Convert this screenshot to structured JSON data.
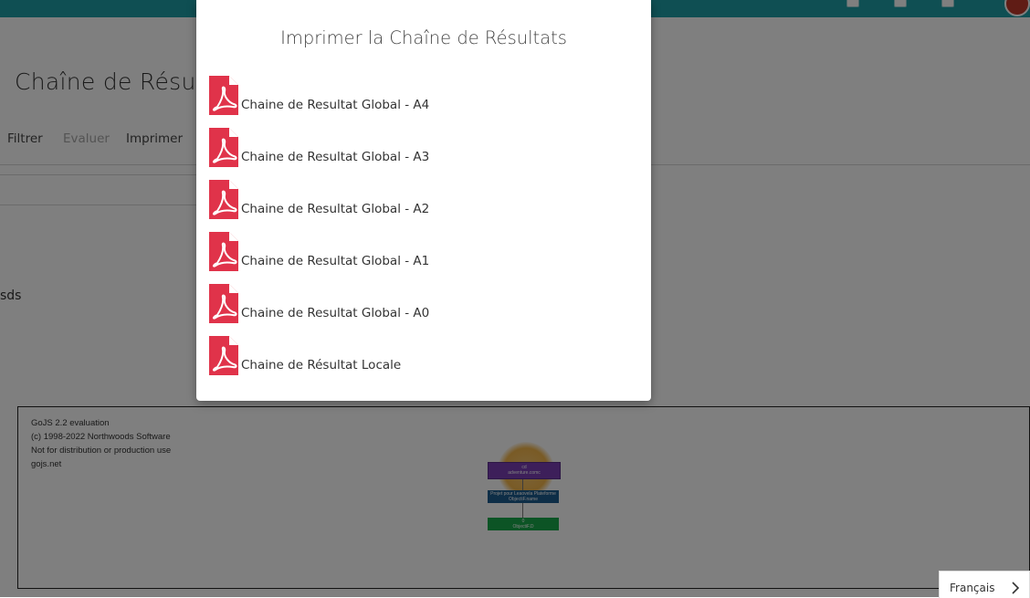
{
  "header": {
    "avatar_color": "#c0392b",
    "bar_color": "#1f9fa6"
  },
  "page": {
    "title": "Chaîne de Résulta",
    "nav": {
      "filter": "Filtrer",
      "evaluate": "Evaluer",
      "print": "Imprimer"
    },
    "stray_text": "sds"
  },
  "diagram": {
    "evaluation_lines": [
      "GoJS 2.2 evaluation",
      "(c) 1998-2022 Northwoods Software",
      "Not for distribution or production use",
      "gojs.net"
    ],
    "nodes": [
      {
        "line1": "cd",
        "line2": "adventure.comc",
        "color": "#7a3fb5"
      },
      {
        "line1": "Projet pour Leaovela Plateforme",
        "line2": "ObjectiF.name",
        "color": "#1d5c8e"
      },
      {
        "line1": "0",
        "line2": "ObjectiF.D",
        "color": "#18a84a"
      }
    ]
  },
  "modal": {
    "title": "Imprimer la Chaîne de Résultats",
    "icon": "pdf-file-icon",
    "icon_color": "#e0334a",
    "items": [
      {
        "label": "Chaine de Resultat Global - A4"
      },
      {
        "label": "Chaine de Resultat Global - A3"
      },
      {
        "label": "Chaine de Resultat Global - A2"
      },
      {
        "label": "Chaine de Resultat Global - A1"
      },
      {
        "label": "Chaine de Resultat Global - A0"
      },
      {
        "label": "Chaine de Résultat Locale"
      }
    ]
  },
  "language": {
    "label": "Français",
    "icon": "chevron-right-icon"
  }
}
